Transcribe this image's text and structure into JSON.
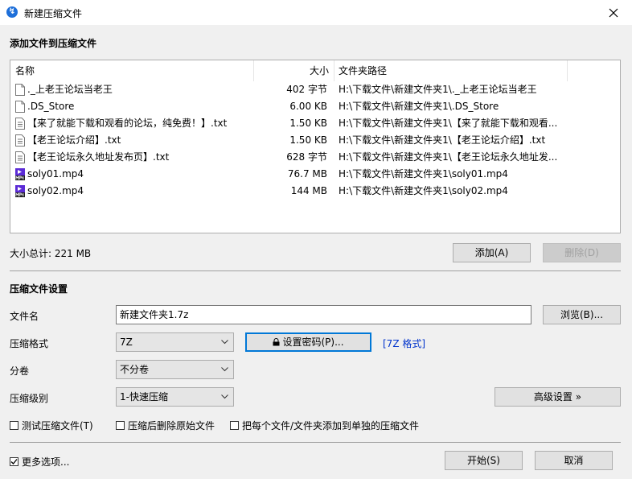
{
  "window": {
    "title": "新建压缩文件"
  },
  "add_section": {
    "title": "添加文件到压缩文件",
    "columns": {
      "name": "名称",
      "size": "大小",
      "path": "文件夹路径"
    },
    "files": [
      {
        "name": "._上老王论坛当老王",
        "size": "402 字节",
        "path": "H:\\下载文件\\新建文件夹1\\._上老王论坛当老王",
        "icon": "file-icon"
      },
      {
        "name": ".DS_Store",
        "size": "6.00 KB",
        "path": "H:\\下载文件\\新建文件夹1\\.DS_Store",
        "icon": "file-icon"
      },
      {
        "name": "【来了就能下载和观看的论坛，纯免费！】.txt",
        "size": "1.50 KB",
        "path": "H:\\下载文件\\新建文件夹1\\【来了就能下载和观看...",
        "icon": "text-file-icon"
      },
      {
        "name": "【老王论坛介绍】.txt",
        "size": "1.50 KB",
        "path": "H:\\下载文件\\新建文件夹1\\【老王论坛介绍】.txt",
        "icon": "text-file-icon"
      },
      {
        "name": "【老王论坛永久地址发布页】.txt",
        "size": "628 字节",
        "path": "H:\\下载文件\\新建文件夹1\\【老王论坛永久地址发...",
        "icon": "text-file-icon"
      },
      {
        "name": "soly01.mp4",
        "size": "76.7 MB",
        "path": "H:\\下载文件\\新建文件夹1\\soly01.mp4",
        "icon": "video-file-icon"
      },
      {
        "name": "soly02.mp4",
        "size": "144 MB",
        "path": "H:\\下载文件\\新建文件夹1\\soly02.mp4",
        "icon": "video-file-icon"
      }
    ],
    "total_size": "大小总计: 221 MB",
    "add_button": "添加(A)",
    "delete_button": "删除(D)"
  },
  "settings": {
    "title": "压缩文件设置",
    "filename_label": "文件名",
    "filename_value": "新建文件夹1.7z",
    "browse_button": "浏览(B)...",
    "format_label": "压缩格式",
    "format_value": "7Z",
    "set_password_button": "设置密码(P)...",
    "format_hint": "[7Z 格式]",
    "split_label": "分卷",
    "split_value": "不分卷",
    "level_label": "压缩级别",
    "level_value": "1-快速压缩",
    "advanced_button": "高级设置 »",
    "test_checkbox": "测试压缩文件(T)",
    "delete_after_checkbox": "压缩后删除原始文件",
    "separate_checkbox": "把每个文件/文件夹添加到单独的压缩文件"
  },
  "footer": {
    "more_options": "更多选项...",
    "more_options_checked": true,
    "start_button": "开始(S)",
    "cancel_button": "取消"
  },
  "colors": {
    "link": "#0033cc",
    "focus": "#0078d7",
    "video_icon": "#5b2bd6"
  }
}
